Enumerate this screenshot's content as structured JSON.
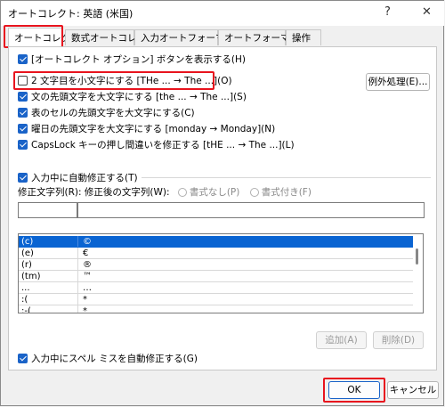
{
  "window": {
    "title": "オートコレクト: 英語 (米国)",
    "help": "?",
    "close": "✕"
  },
  "tabs": [
    "オートコレクト",
    "数式オートコレクト",
    "入力オートフォーマット",
    "オートフォーマット",
    "操作"
  ],
  "options": {
    "show_buttons": "[オートコレクト オプション] ボタンを表示する(H)",
    "two_initial_caps": "2 文字目を小文字にする [THe ... → The ...](O)",
    "first_letter_sentences": "文の先頭文字を大文字にする [the ... → The ...](S)",
    "first_letter_cells": "表のセルの先頭文字を大文字にする(C)",
    "day_names": "曜日の先頭文字を大文字にする [monday → Monday](N)",
    "caps_lock": "CapsLock キーの押し間違いを修正する [tHE ... → The ...](L)",
    "exceptions_button": "例外処理(E)..."
  },
  "replace": {
    "checkbox_label": "入力中に自動修正する(T)",
    "field_label": "修正文字列(R): 修正後の文字列(W):",
    "radio_plain": "書式なし(P)",
    "radio_formatted": "書式付き(F)",
    "replace_value": "",
    "with_value": ""
  },
  "entries": [
    {
      "from": "(c)",
      "to": "©"
    },
    {
      "from": "(e)",
      "to": "€"
    },
    {
      "from": "(r)",
      "to": "®"
    },
    {
      "from": "(tm)",
      "to": "™"
    },
    {
      "from": "...",
      "to": "…"
    },
    {
      "from": ":(",
      "to": "*"
    },
    {
      "from": ":-(",
      "to": "*"
    }
  ],
  "buttons": {
    "add": "追加(A)",
    "delete": "削除(D)",
    "ok": "OK",
    "cancel": "キャンセル"
  },
  "spell_option": "入力中にスペル ミスを自動修正する(G)",
  "colors": {
    "accent": "#1a63c8",
    "highlight": "#e8141e",
    "selection": "#0a64d2"
  }
}
